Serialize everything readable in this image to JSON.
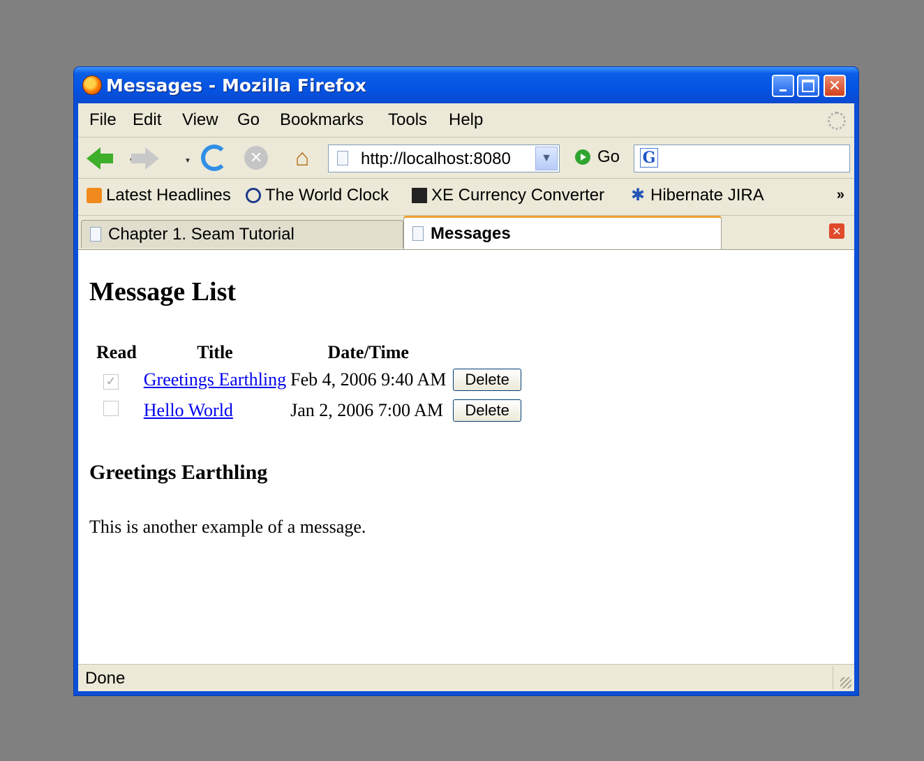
{
  "window": {
    "title": "Messages - Mozilla Firefox"
  },
  "menu": [
    "File",
    "Edit",
    "View",
    "Go",
    "Bookmarks",
    "Tools",
    "Help"
  ],
  "nav": {
    "url": "http://localhost:8080",
    "go_label": "Go",
    "search_engine_letter": "G"
  },
  "bookmarks": [
    {
      "label": "Latest Headlines",
      "icon": "rss-icon"
    },
    {
      "label": "The World Clock",
      "icon": "world-clock-icon"
    },
    {
      "label": "XE Currency Converter",
      "icon": "xe-icon"
    },
    {
      "label": "Hibernate JIRA",
      "icon": "jira-icon"
    }
  ],
  "tabs": [
    {
      "label": "Chapter 1. Seam Tutorial",
      "active": false
    },
    {
      "label": "Messages",
      "active": true
    }
  ],
  "page": {
    "heading": "Message List",
    "columns": [
      "Read",
      "Title",
      "Date/Time"
    ],
    "rows": [
      {
        "read": true,
        "title": "Greetings Earthling",
        "datetime": "Feb 4, 2006 9:40 AM",
        "action": "Delete"
      },
      {
        "read": false,
        "title": "Hello World",
        "datetime": "Jan 2, 2006 7:00 AM",
        "action": "Delete"
      }
    ],
    "selected_title": "Greetings Earthling",
    "selected_body": "This is another example of a message."
  },
  "status": {
    "text": "Done"
  }
}
